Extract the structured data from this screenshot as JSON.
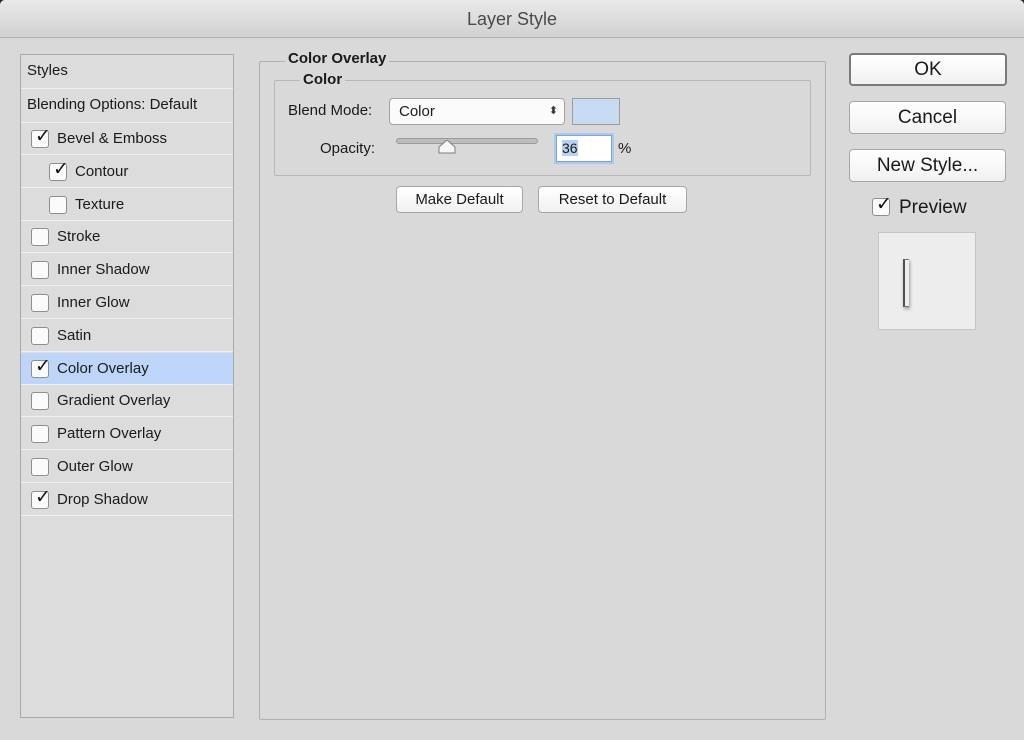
{
  "window": {
    "title": "Layer Style"
  },
  "styles_list": {
    "header": "Styles",
    "blending_options": "Blending Options: Default",
    "items": [
      {
        "label": "Bevel & Emboss",
        "checked": true,
        "indent": false,
        "selected": false
      },
      {
        "label": "Contour",
        "checked": true,
        "indent": true,
        "selected": false
      },
      {
        "label": "Texture",
        "checked": false,
        "indent": true,
        "selected": false
      },
      {
        "label": "Stroke",
        "checked": false,
        "indent": false,
        "selected": false
      },
      {
        "label": "Inner Shadow",
        "checked": false,
        "indent": false,
        "selected": false
      },
      {
        "label": "Inner Glow",
        "checked": false,
        "indent": false,
        "selected": false
      },
      {
        "label": "Satin",
        "checked": false,
        "indent": false,
        "selected": false
      },
      {
        "label": "Color Overlay",
        "checked": true,
        "indent": false,
        "selected": true
      },
      {
        "label": "Gradient Overlay",
        "checked": false,
        "indent": false,
        "selected": false
      },
      {
        "label": "Pattern Overlay",
        "checked": false,
        "indent": false,
        "selected": false
      },
      {
        "label": "Outer Glow",
        "checked": false,
        "indent": false,
        "selected": false
      },
      {
        "label": "Drop Shadow",
        "checked": true,
        "indent": false,
        "selected": false
      }
    ]
  },
  "panel": {
    "section_title": "Color Overlay",
    "group_title": "Color",
    "blend_mode_label": "Blend Mode:",
    "blend_mode_value": "Color",
    "overlay_color": "#c6dbf1",
    "opacity_label": "Opacity:",
    "opacity_value": "36",
    "opacity_unit": "%",
    "opacity_fraction": 0.36,
    "make_default": "Make Default",
    "reset_to_default": "Reset to Default"
  },
  "actions": {
    "ok": "OK",
    "cancel": "Cancel",
    "new_style": "New Style...",
    "preview_label": "Preview",
    "preview_checked": true
  },
  "colors": {
    "selection": "#bcd5f8",
    "dialog_bg": "#d9d9d9"
  }
}
